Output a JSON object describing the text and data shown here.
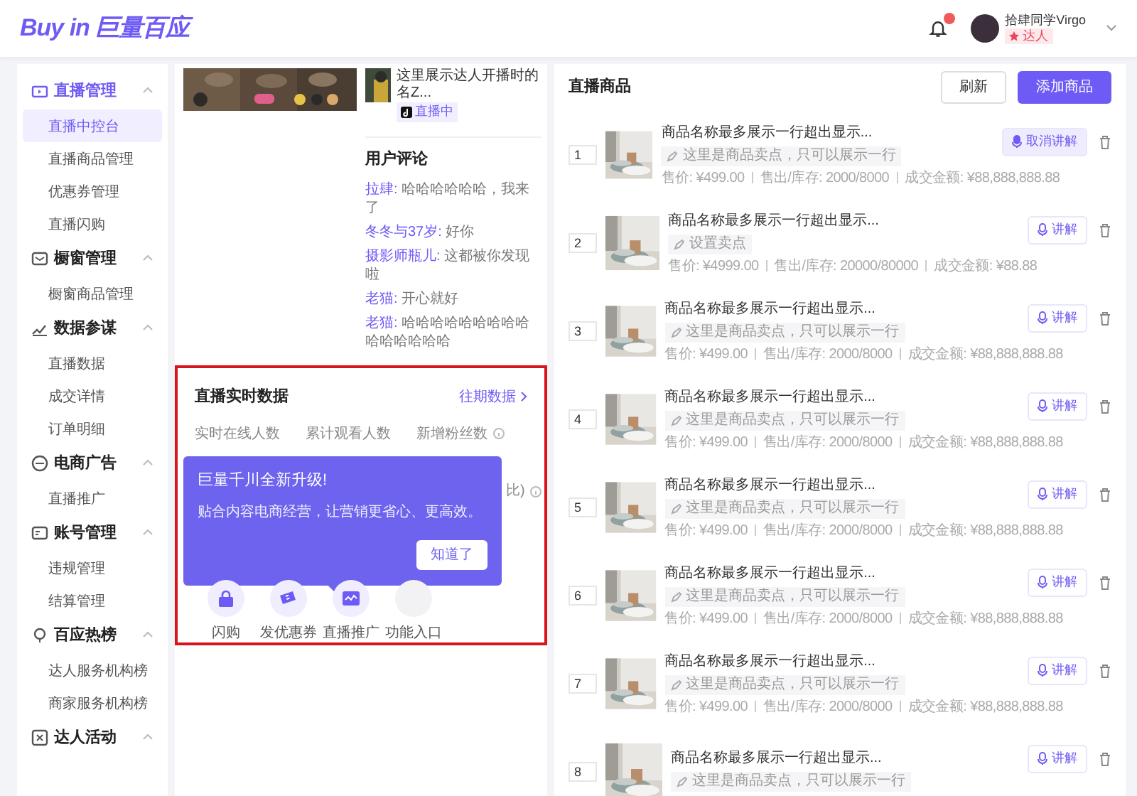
{
  "header": {
    "logo_latin": "Buy in",
    "logo_cjk": "巨量百应",
    "has_unread": true,
    "user": {
      "name": "拾肆同学Virgo",
      "role": "达人"
    }
  },
  "sidebar": {
    "groups": [
      {
        "label": "直播管理",
        "expanded": true,
        "items": [
          {
            "label": "直播中控台",
            "selected": true
          },
          {
            "label": "直播商品管理",
            "selected": false
          },
          {
            "label": "优惠券管理",
            "selected": false
          },
          {
            "label": "直播闪购",
            "selected": false
          }
        ]
      },
      {
        "label": "橱窗管理",
        "expanded": true,
        "items": [
          {
            "label": "橱窗商品管理",
            "selected": false
          }
        ]
      },
      {
        "label": "数据参谋",
        "expanded": true,
        "items": [
          {
            "label": "直播数据",
            "selected": false
          },
          {
            "label": "成交详情",
            "selected": false
          },
          {
            "label": "订单明细",
            "selected": false
          }
        ]
      },
      {
        "label": "电商广告",
        "expanded": true,
        "items": [
          {
            "label": "直播推广",
            "selected": false
          }
        ]
      },
      {
        "label": "账号管理",
        "expanded": true,
        "items": [
          {
            "label": "违规管理",
            "selected": false
          },
          {
            "label": "结算管理",
            "selected": false
          }
        ]
      },
      {
        "label": "百应热榜",
        "expanded": true,
        "items": [
          {
            "label": "达人服务机构榜",
            "selected": false
          },
          {
            "label": "商家服务机构榜",
            "selected": false
          }
        ]
      },
      {
        "label": "达人活动",
        "expanded": true
      }
    ]
  },
  "live": {
    "title": "这里展示达人开播时的名Z...",
    "status": "直播中",
    "comments_title": "用户评论",
    "comments": [
      {
        "user": "拉肆:",
        "text": "哈哈哈哈哈哈，我来了"
      },
      {
        "user": "冬冬与37岁:",
        "text": "好你"
      },
      {
        "user": "摄影师瓶儿:",
        "text": "这都被你发现啦"
      },
      {
        "user": "老猫:",
        "text": "开心就好"
      },
      {
        "user": "老猫:",
        "text": "哈哈哈哈哈哈哈哈哈哈哈哈哈哈哈"
      }
    ]
  },
  "realtime": {
    "title": "直播实时数据",
    "link": "往期数据",
    "metrics": [
      {
        "label": "实时在线人数",
        "info": false
      },
      {
        "label": "累计观看人数",
        "info": false
      },
      {
        "label": "新增粉丝数",
        "info": true
      }
    ],
    "covered_label_tail": "比)",
    "popover": {
      "title": "巨量千川全新升级!",
      "text": "贴合内容电商经营，让营销更省心、更高效。",
      "button": "知道了"
    },
    "tools": [
      {
        "label": "闪购",
        "kind": "lock"
      },
      {
        "label": "发优惠券",
        "kind": "ticket"
      },
      {
        "label": "直播推广",
        "kind": "promo"
      },
      {
        "label": "功能入口",
        "kind": "empty"
      }
    ]
  },
  "products": {
    "title": "直播商品",
    "refresh": "刷新",
    "add": "添加商品",
    "items": [
      {
        "index": "1",
        "name": "商品名称最多展示一行超出显示...",
        "selling_point": "这里是商品卖点，只可以展示一行",
        "price": "售价: ¥499.00",
        "stock": "售出/库存: 2000/8000",
        "amount": "成交金额: ¥88,888,888.88",
        "explaining": true,
        "action": "取消讲解"
      },
      {
        "index": "2",
        "name": "商品名称最多展示一行超出显示...",
        "selling_point": "设置卖点",
        "price": "售价: ¥4999.00",
        "stock": "售出/库存: 20000/80000",
        "amount": "成交金额: ¥88.88",
        "explaining": false,
        "action": "讲解"
      },
      {
        "index": "3",
        "name": "商品名称最多展示一行超出显示...",
        "selling_point": "这里是商品卖点，只可以展示一行",
        "price": "售价: ¥499.00",
        "stock": "售出/库存: 2000/8000",
        "amount": "成交金额: ¥88,888,888.88",
        "explaining": false,
        "action": "讲解"
      },
      {
        "index": "4",
        "name": "商品名称最多展示一行超出显示...",
        "selling_point": "这里是商品卖点，只可以展示一行",
        "price": "售价: ¥499.00",
        "stock": "售出/库存: 2000/8000",
        "amount": "成交金额: ¥88,888,888.88",
        "explaining": false,
        "action": "讲解"
      },
      {
        "index": "5",
        "name": "商品名称最多展示一行超出显示...",
        "selling_point": "这里是商品卖点，只可以展示一行",
        "price": "售价: ¥499.00",
        "stock": "售出/库存: 2000/8000",
        "amount": "成交金额: ¥88,888,888.88",
        "explaining": false,
        "action": "讲解"
      },
      {
        "index": "6",
        "name": "商品名称最多展示一行超出显示...",
        "selling_point": "这里是商品卖点，只可以展示一行",
        "price": "售价: ¥499.00",
        "stock": "售出/库存: 2000/8000",
        "amount": "成交金额: ¥88,888,888.88",
        "explaining": false,
        "action": "讲解"
      },
      {
        "index": "7",
        "name": "商品名称最多展示一行超出显示...",
        "selling_point": "这里是商品卖点，只可以展示一行",
        "price": "售价: ¥499.00",
        "stock": "售出/库存: 2000/8000",
        "amount": "成交金额: ¥88,888,888.88",
        "explaining": false,
        "action": "讲解"
      },
      {
        "index": "8",
        "name": "商品名称最多展示一行超出显示...",
        "selling_point": "这里是商品卖点，只可以展示一行",
        "explaining": false,
        "action": "讲解"
      }
    ]
  }
}
